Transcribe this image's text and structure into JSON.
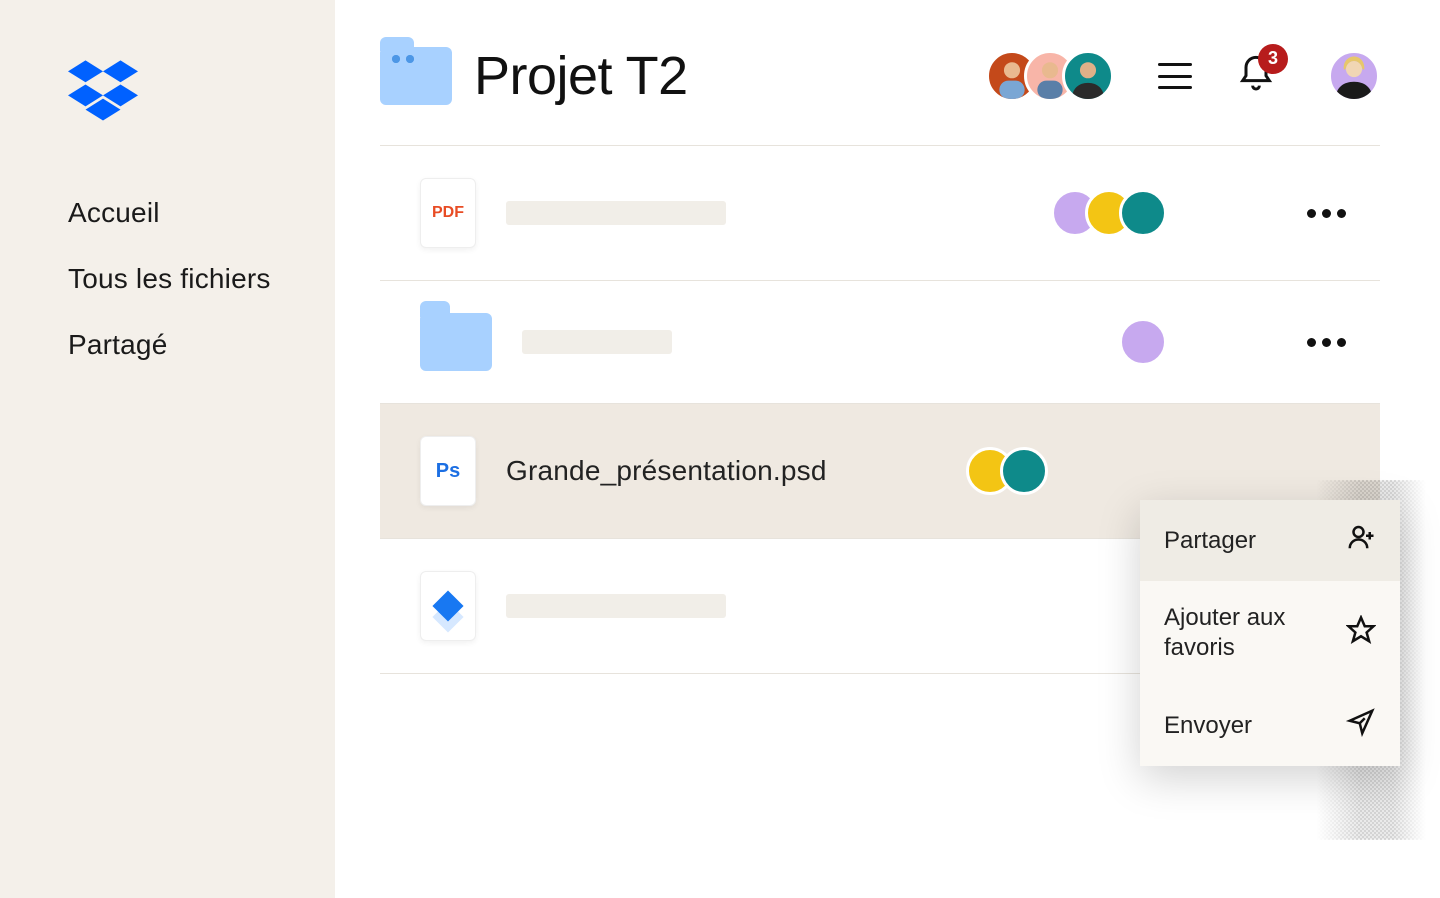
{
  "brand": "Dropbox",
  "sidebar": {
    "items": [
      {
        "label": "Accueil"
      },
      {
        "label": "Tous les fichiers"
      },
      {
        "label": "Partagé"
      }
    ]
  },
  "header": {
    "title": "Projet T2",
    "notification_count": "3",
    "collaborators": [
      {
        "bg": "#c4491a"
      },
      {
        "bg": "#f8b5a8"
      },
      {
        "bg": "#0e8a8a"
      }
    ],
    "profile_bg": "#c7a9ef"
  },
  "files": [
    {
      "type": "pdf",
      "type_label": "PDF",
      "name": null,
      "selected": false,
      "collaborators": [
        {
          "bg": "#c7a9ef"
        },
        {
          "bg": "#f3c514"
        },
        {
          "bg": "#0e8a8a"
        }
      ],
      "show_overflow": true
    },
    {
      "type": "folder",
      "name": null,
      "selected": false,
      "collaborators": [
        {
          "bg": "#c7a9ef"
        }
      ],
      "show_overflow": true
    },
    {
      "type": "psd",
      "type_label": "Ps",
      "name": "Grande_présentation.psd",
      "selected": true,
      "collaborators": [
        {
          "bg": "#f3c514"
        },
        {
          "bg": "#0e8a8a"
        }
      ],
      "show_overflow": false
    },
    {
      "type": "paper",
      "name": null,
      "selected": false,
      "collaborators": [
        {
          "bg": "#c7a9ef"
        }
      ],
      "show_overflow": false
    }
  ],
  "context_menu": {
    "items": [
      {
        "label": "Partager",
        "icon": "person-add-icon",
        "highlight": true
      },
      {
        "label": "Ajouter aux favoris",
        "icon": "star-icon",
        "highlight": false
      },
      {
        "label": "Envoyer",
        "icon": "paper-plane-icon",
        "highlight": false
      }
    ]
  }
}
